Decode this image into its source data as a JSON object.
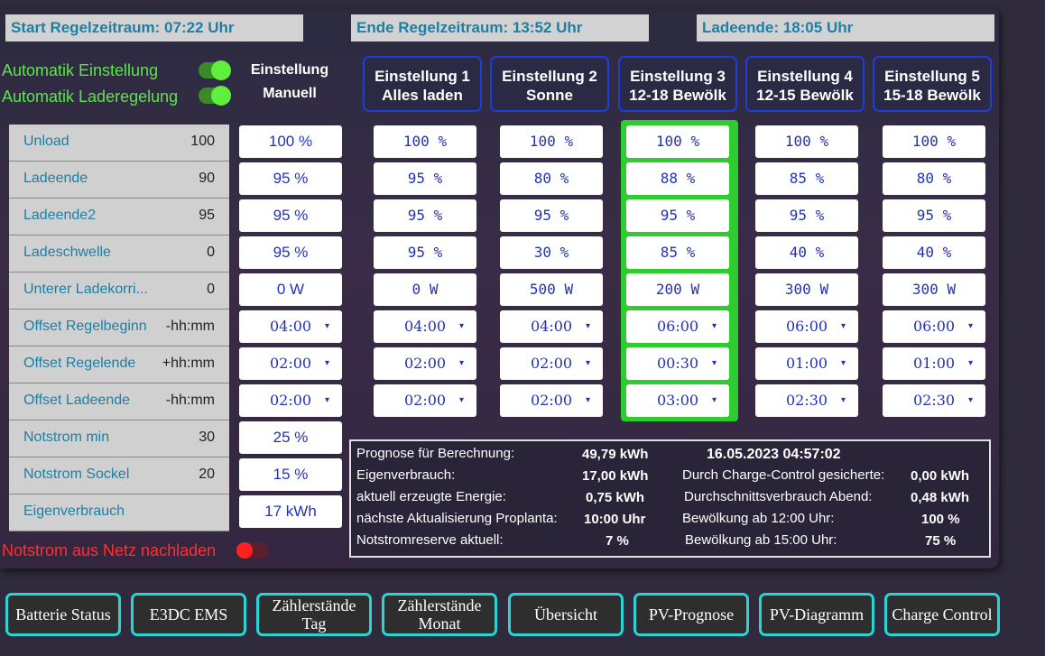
{
  "header": {
    "start": "Start Regelzeitraum: 07:22 Uhr",
    "ende": "Ende Regelzeitraum: 13:52 Uhr",
    "ladeende": "Ladeende: 18:05 Uhr"
  },
  "automatik": {
    "einstellung": "Automatik Einstellung",
    "laderegelung": "Automatik Laderegelung",
    "manual_title": "Einstellung",
    "manual_sub": "Manuell"
  },
  "settings_headers": [
    {
      "line1": "Einstellung 1",
      "line2": "Alles laden"
    },
    {
      "line1": "Einstellung 2",
      "line2": "Sonne"
    },
    {
      "line1": "Einstellung 3",
      "line2": "12-18 Bewölk"
    },
    {
      "line1": "Einstellung 4",
      "line2": "12-15 Bewölk"
    },
    {
      "line1": "Einstellung 5",
      "line2": "15-18 Bewölk"
    }
  ],
  "rows": [
    {
      "label": "Unload",
      "current": "100",
      "manual": "100 %",
      "sets": [
        "100 %",
        "100 %",
        "100 %",
        "100 %",
        "100 %"
      ]
    },
    {
      "label": "Ladeende",
      "current": "90",
      "manual": "95 %",
      "sets": [
        "95 %",
        "80 %",
        "88 %",
        "85 %",
        "80 %"
      ]
    },
    {
      "label": "Ladeende2",
      "current": "95",
      "manual": "95 %",
      "sets": [
        "95 %",
        "95 %",
        "95 %",
        "95 %",
        "95 %"
      ]
    },
    {
      "label": "Ladeschwelle",
      "current": "0",
      "manual": "95 %",
      "sets": [
        "95 %",
        "30 %",
        "85 %",
        "40 %",
        "40 %"
      ]
    },
    {
      "label": "Unterer Ladekorri...",
      "current": "0",
      "manual": "0 W",
      "sets": [
        "0 W",
        "500 W",
        "200 W",
        "300 W",
        "300 W"
      ]
    },
    {
      "label": "Offset Regelbeginn",
      "current": "-hh:mm",
      "manual": "04:00",
      "sets": [
        "04:00",
        "04:00",
        "06:00",
        "06:00",
        "06:00"
      ]
    },
    {
      "label": "Offset Regelende",
      "current": "+hh:mm",
      "manual": "02:00",
      "sets": [
        "02:00",
        "02:00",
        "00:30",
        "01:00",
        "01:00"
      ]
    },
    {
      "label": "Offset Ladeende",
      "current": "-hh:mm",
      "manual": "02:00",
      "sets": [
        "02:00",
        "02:00",
        "03:00",
        "02:30",
        "02:30"
      ]
    },
    {
      "label": "Notstrom min",
      "current": "30",
      "manual": "25 %"
    },
    {
      "label": "Notstrom Sockel",
      "current": "20",
      "manual": "15 %"
    },
    {
      "label": "Eigenverbrauch",
      "current": "",
      "manual": "17 kWh"
    }
  ],
  "info": {
    "prognose_label": "Prognose für Berechnung:",
    "prognose_value": "49,79 kWh",
    "datetime": "16.05.2023 04:57:02",
    "eigen_label": "Eigenverbrauch:",
    "eigen_value": "17,00 kWh",
    "gesichert_label": "Durch Charge-Control gesicherte:",
    "gesichert_value": "0,00 kWh",
    "erzeugt_label": "aktuell erzeugte Energie:",
    "erzeugt_value": "0,75 kWh",
    "abend_label": "Durchschnittsverbrauch Abend:",
    "abend_value": "0,48 kWh",
    "update_label": "nächste Aktualisierung Proplanta:",
    "update_value": "10:00 Uhr",
    "bew12_label": "Bewölkung ab 12:00 Uhr:",
    "bew12_value": "100 %",
    "reserve_label": "Notstromreserve aktuell:",
    "reserve_value": "7 %",
    "bew15_label": "Bewölkung ab 15:00 Uhr:",
    "bew15_value": "75 %"
  },
  "notstrom_nachladen": "Notstrom aus Netz nachladen",
  "nav": [
    {
      "label": "Batterie Status"
    },
    {
      "label": "E3DC EMS"
    },
    {
      "label": "Zählerstände Tag"
    },
    {
      "label": "Zählerstände Monat"
    },
    {
      "label": "Übersicht"
    },
    {
      "label": "PV-Prognose"
    },
    {
      "label": "PV-Diagramm"
    },
    {
      "label": "Charge Control"
    }
  ],
  "active_setting": 3,
  "colors": {
    "accent": "#1e7fa6",
    "active": "#2ecc2e",
    "setting_border": "#1f3dd8",
    "nav_border": "#2ad4d4"
  }
}
